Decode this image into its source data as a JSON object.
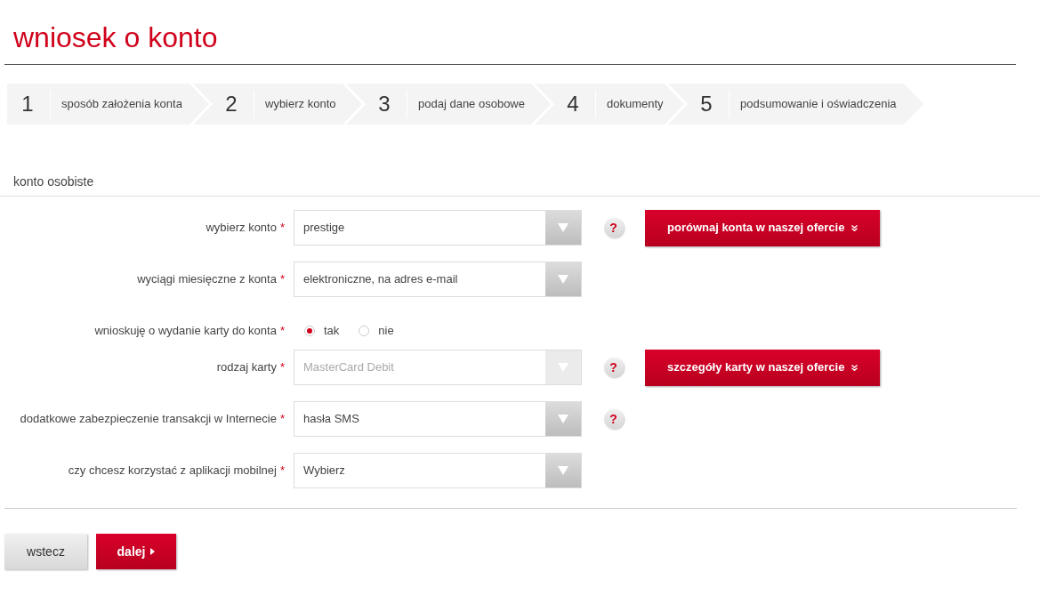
{
  "title": "wniosek o konto",
  "steps": [
    {
      "number": "1",
      "label": "sposób założenia konta"
    },
    {
      "number": "2",
      "label": "wybierz konto"
    },
    {
      "number": "3",
      "label": "podaj dane osobowe"
    },
    {
      "number": "4",
      "label": "dokumenty"
    },
    {
      "number": "5",
      "label": "podsumowanie i oświadczenia"
    }
  ],
  "section_title": "konto osobiste",
  "fields": [
    {
      "kind": "select",
      "label": "wybierz konto",
      "required_mark": "*",
      "value": "prestige",
      "disabled": false,
      "help": "?",
      "action": "porównaj konta w naszej ofercie"
    },
    {
      "kind": "select",
      "label": "wyciągi miesięczne z konta",
      "required_mark": "*",
      "value": "elektroniczne, na adres e-mail",
      "disabled": false
    },
    {
      "kind": "radio",
      "label": "wnioskuję o wydanie karty do konta",
      "required_mark": "*",
      "options": [
        {
          "label": "tak",
          "selected": true
        },
        {
          "label": "nie",
          "selected": false
        }
      ]
    },
    {
      "kind": "select",
      "label": "rodzaj karty",
      "required_mark": "*",
      "value": "MasterCard Debit",
      "disabled": true,
      "help": "?",
      "action": "szczegóły karty w naszej ofercie"
    },
    {
      "kind": "select",
      "label": "dodatkowe zabezpieczenie transakcji w Internecie",
      "required_mark": "*",
      "value": "hasła SMS",
      "disabled": false,
      "help": "?"
    },
    {
      "kind": "select",
      "label": "czy chcesz korzystać z aplikacji mobilnej",
      "required_mark": "*",
      "value": "Wybierz",
      "disabled": false
    }
  ],
  "buttons": {
    "back": "wstecz",
    "next": "dalej"
  }
}
